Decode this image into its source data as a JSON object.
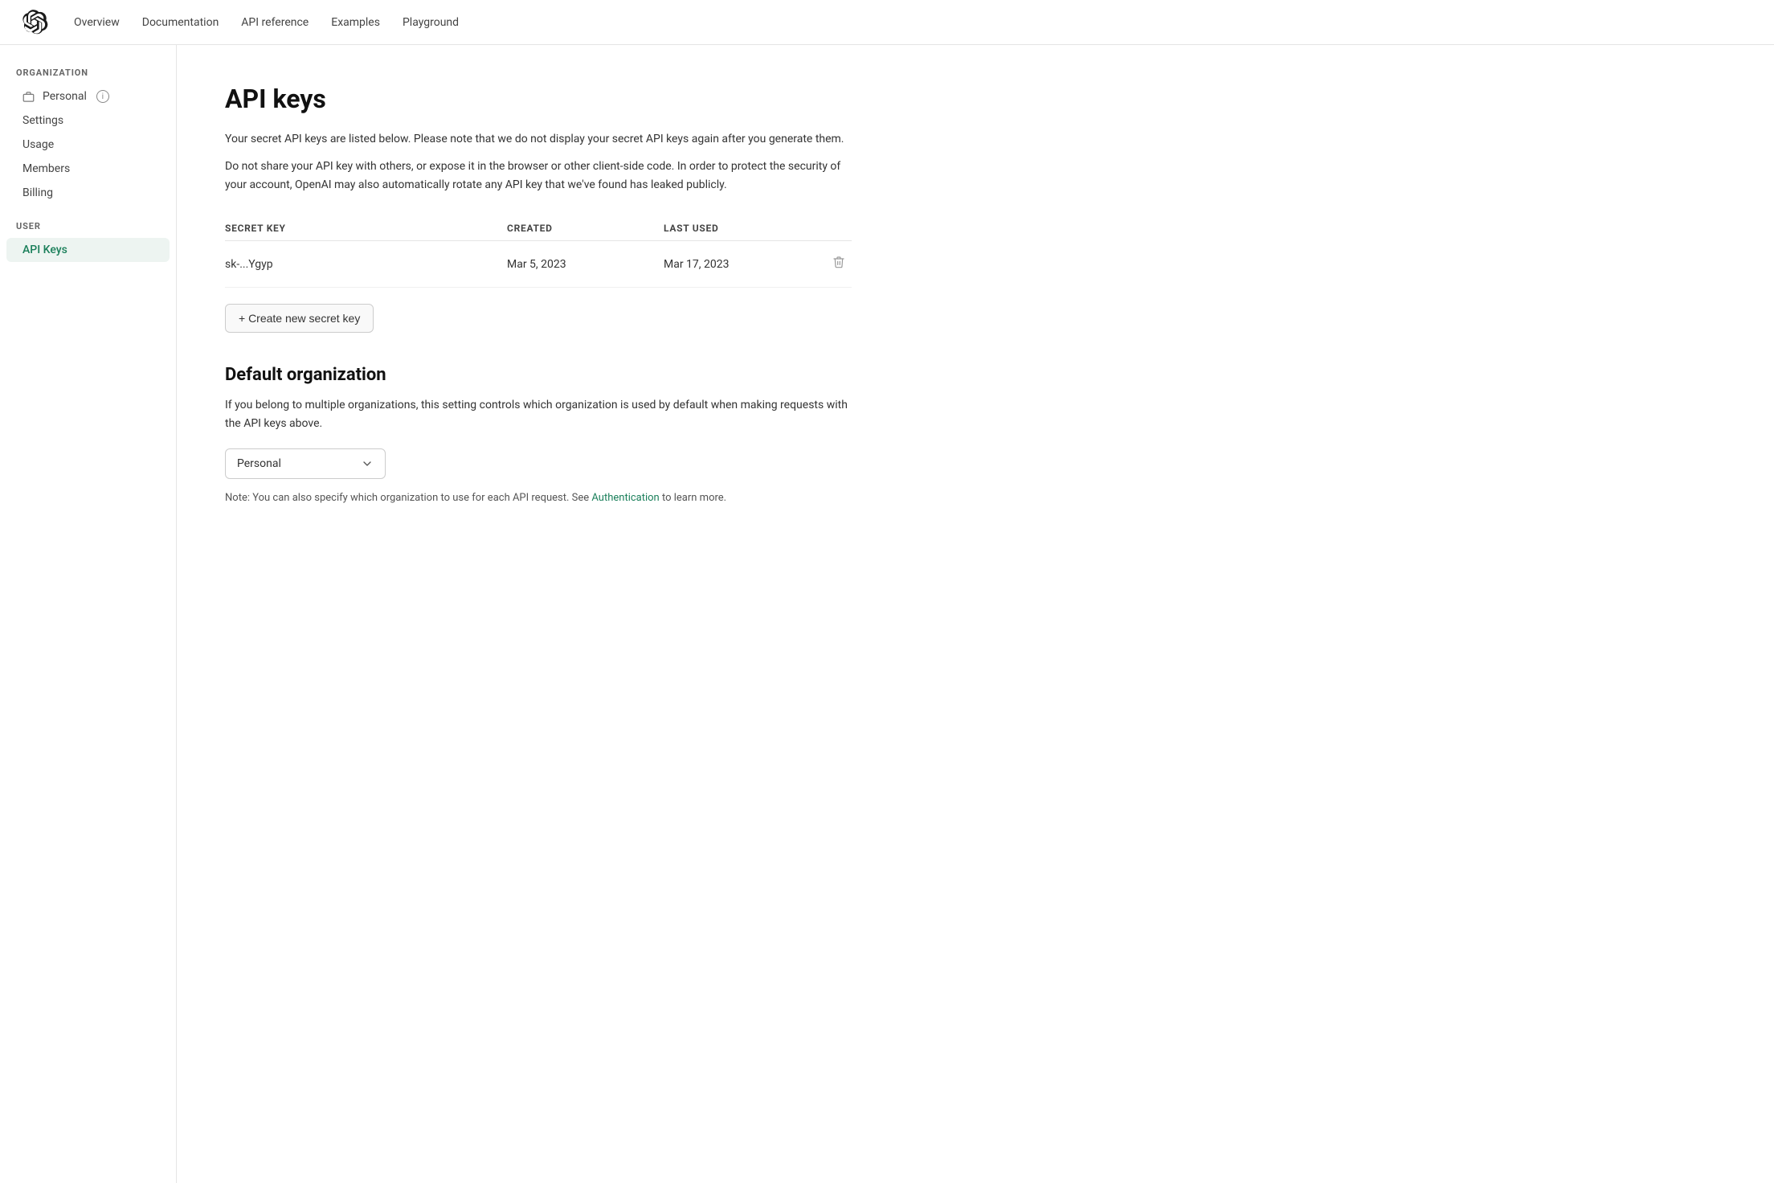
{
  "nav": {
    "links": [
      "Overview",
      "Documentation",
      "API reference",
      "Examples",
      "Playground"
    ]
  },
  "sidebar": {
    "org_section_label": "ORGANIZATION",
    "org_name": "Personal",
    "org_items": [
      "Settings",
      "Usage",
      "Members",
      "Billing"
    ],
    "user_section_label": "USER",
    "user_items": [
      "API Keys"
    ]
  },
  "main": {
    "page_title": "API keys",
    "description1": "Your secret API keys are listed below. Please note that we do not display your secret API keys again after you generate them.",
    "description2": "Do not share your API key with others, or expose it in the browser or other client-side code. In order to protect the security of your account, OpenAI may also automatically rotate any API key that we've found has leaked publicly.",
    "table": {
      "headers": [
        "SECRET KEY",
        "CREATED",
        "LAST USED",
        ""
      ],
      "rows": [
        {
          "key": "sk-...Ygyp",
          "created": "Mar 5, 2023",
          "last_used": "Mar 17, 2023"
        }
      ]
    },
    "create_button_label": "+ Create new secret key",
    "default_org_title": "Default organization",
    "default_org_description": "If you belong to multiple organizations, this setting controls which organization is used by default when making requests with the API keys above.",
    "org_dropdown_value": "Personal",
    "note_text": "Note: You can also specify which organization to use for each API request. See ",
    "note_link": "Authentication",
    "note_text2": " to learn more."
  }
}
